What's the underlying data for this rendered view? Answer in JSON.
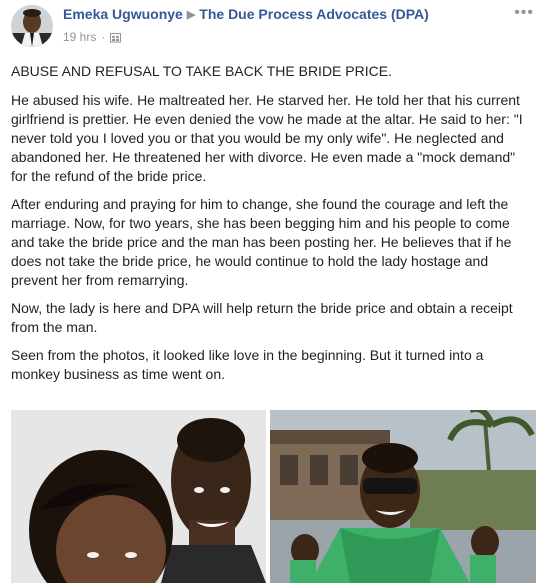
{
  "post": {
    "author": "Emeka Ugwuonye",
    "group": "The Due Process Advocates (DPA)",
    "time": "19 hrs",
    "more_label": "•••",
    "paragraphs": [
      "ABUSE AND REFUSAL TO TAKE BACK THE BRIDE PRICE.",
      "He abused his wife. He maltreated her. He starved her. He told her that his current girlfriend is prettier. He even denied the vow he made at the altar. He said to her: \"I never told you I loved you or that you would be my only wife\". He neglected and abandoned her. He threatened her with divorce. He even made a \"mock demand\" for the refund of the bride price.",
      "After enduring and praying for him to change, she found the courage and left the marriage. Now, for two years, she has been begging him and his people to come and take the bride price and the man has been posting her. He believes that if he does not take the bride price, he would continue to hold the lady hostage and prevent her from remarrying.",
      "Now, the lady is here and DPA will help return the bride price and obtain a receipt from the man.",
      "Seen from the photos, it looked like love in the beginning. But it turned into a monkey business as time went on."
    ]
  },
  "icons": {
    "arrow": "▶",
    "privacy": "group-privacy-icon"
  }
}
